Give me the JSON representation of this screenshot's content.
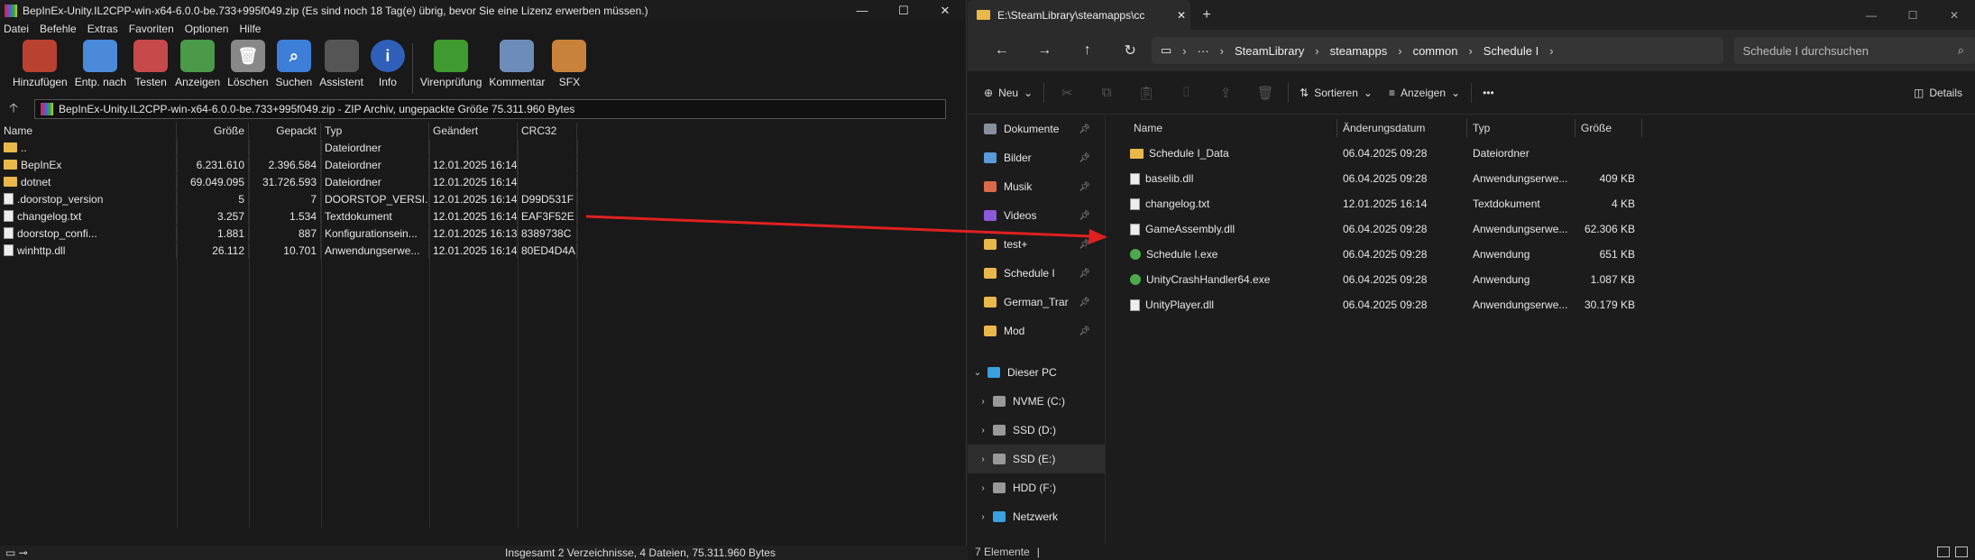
{
  "winrar": {
    "title": "BepInEx-Unity.IL2CPP-win-x64-6.0.0-be.733+995f049.zip (Es sind noch 18 Tag(e) übrig, bevor Sie eine Lizenz erwerben müssen.)",
    "menu": [
      "Datei",
      "Befehle",
      "Extras",
      "Favoriten",
      "Optionen",
      "Hilfe"
    ],
    "toolbar": [
      {
        "label": "Hinzufügen",
        "icon": "books-add-icon",
        "color": "#b9412f"
      },
      {
        "label": "Entp. nach",
        "icon": "folder-extract-icon",
        "color": "#4a8ad8"
      },
      {
        "label": "Testen",
        "icon": "clipboard-check-icon",
        "color": "#c64a4a"
      },
      {
        "label": "Anzeigen",
        "icon": "book-view-icon",
        "color": "#4a9a4a"
      },
      {
        "label": "Löschen",
        "icon": "trash-icon",
        "color": "#888"
      },
      {
        "label": "Suchen",
        "icon": "magnifier-icon",
        "color": "#3d7ed8"
      },
      {
        "label": "Assistent",
        "icon": "wand-icon",
        "color": "#555"
      },
      {
        "label": "Info",
        "icon": "info-icon",
        "color": "#2f5fb8"
      },
      {
        "label": "Virenprüfung",
        "icon": "bug-scan-icon",
        "color": "#3f9a2f"
      },
      {
        "label": "Kommentar",
        "icon": "comment-icon",
        "color": "#6d8db8"
      },
      {
        "label": "SFX",
        "icon": "sfx-books-icon",
        "color": "#c9823a"
      }
    ],
    "address": "BepInEx-Unity.IL2CPP-win-x64-6.0.0-be.733+995f049.zip - ZIP Archiv, ungepackte Größe 75.311.960 Bytes",
    "columns": [
      "Name",
      "Größe",
      "Gepackt",
      "Typ",
      "Geändert",
      "CRC32"
    ],
    "rows": [
      {
        "name": "..",
        "size": "",
        "packed": "",
        "type": "Dateiordner",
        "changed": "",
        "crc": "",
        "kind": "folder"
      },
      {
        "name": "BepInEx",
        "size": "6.231.610",
        "packed": "2.396.584",
        "type": "Dateiordner",
        "changed": "12.01.2025 16:14",
        "crc": "",
        "kind": "folder"
      },
      {
        "name": "dotnet",
        "size": "69.049.095",
        "packed": "31.726.593",
        "type": "Dateiordner",
        "changed": "12.01.2025 16:14",
        "crc": "",
        "kind": "folder"
      },
      {
        "name": ".doorstop_version",
        "size": "5",
        "packed": "7",
        "type": "DOORSTOP_VERSI...",
        "changed": "12.01.2025 16:14",
        "crc": "D99D531F",
        "kind": "file"
      },
      {
        "name": "changelog.txt",
        "size": "3.257",
        "packed": "1.534",
        "type": "Textdokument",
        "changed": "12.01.2025 16:14",
        "crc": "EAF3F52E",
        "kind": "file"
      },
      {
        "name": "doorstop_confi...",
        "size": "1.881",
        "packed": "887",
        "type": "Konfigurationsein...",
        "changed": "12.01.2025 16:13",
        "crc": "8389738C",
        "kind": "file"
      },
      {
        "name": "winhttp.dll",
        "size": "26.112",
        "packed": "10.701",
        "type": "Anwendungserwe...",
        "changed": "12.01.2025 16:14",
        "crc": "80ED4D4A",
        "kind": "file"
      }
    ],
    "status": "Insgesamt 2 Verzeichnisse, 4 Dateien, 75.311.960 Bytes"
  },
  "explorer": {
    "tab_title": "E:\\SteamLibrary\\steamapps\\cc",
    "breadcrumb": [
      "SteamLibrary",
      "steamapps",
      "common",
      "Schedule I"
    ],
    "search_placeholder": "Schedule I durchsuchen",
    "commands": {
      "new": "Neu",
      "sort": "Sortieren",
      "view": "Anzeigen",
      "details": "Details"
    },
    "nav": [
      {
        "label": "Dokumente",
        "icon": "documents-icon",
        "color": "#8a8fa0",
        "pin": true,
        "arrow": ""
      },
      {
        "label": "Bilder",
        "icon": "pictures-icon",
        "color": "#5a9ad8",
        "pin": true,
        "arrow": ""
      },
      {
        "label": "Musik",
        "icon": "music-icon",
        "color": "#d86a4a",
        "pin": true,
        "arrow": ""
      },
      {
        "label": "Videos",
        "icon": "videos-icon",
        "color": "#8a5ad8",
        "pin": true,
        "arrow": ""
      },
      {
        "label": "test+",
        "icon": "folder-icon",
        "color": "#e8b84a",
        "pin": true,
        "arrow": ""
      },
      {
        "label": "Schedule I",
        "icon": "folder-icon",
        "color": "#e8b84a",
        "pin": true,
        "arrow": ""
      },
      {
        "label": "German_Trar",
        "icon": "folder-icon",
        "color": "#e8b84a",
        "pin": true,
        "arrow": ""
      },
      {
        "label": "Mod",
        "icon": "folder-icon",
        "color": "#e8b84a",
        "pin": true,
        "arrow": ""
      },
      {
        "label": "Dieser PC",
        "icon": "pc-icon",
        "color": "#3aa0e0",
        "pin": false,
        "arrow": "v"
      },
      {
        "label": "NVME (C:)",
        "icon": "drive-icon",
        "color": "#999",
        "pin": false,
        "arrow": ">"
      },
      {
        "label": "SSD (D:)",
        "icon": "drive-icon",
        "color": "#999",
        "pin": false,
        "arrow": ">"
      },
      {
        "label": "SSD (E:)",
        "icon": "drive-icon",
        "color": "#999",
        "pin": false,
        "arrow": ">",
        "selected": true
      },
      {
        "label": "HDD (F:)",
        "icon": "drive-icon",
        "color": "#999",
        "pin": false,
        "arrow": ">"
      },
      {
        "label": "Netzwerk",
        "icon": "network-icon",
        "color": "#3aa0e0",
        "pin": false,
        "arrow": ">"
      }
    ],
    "columns": [
      "Name",
      "Änderungsdatum",
      "Typ",
      "Größe"
    ],
    "rows": [
      {
        "name": "Schedule I_Data",
        "date": "06.04.2025 09:28",
        "type": "Dateiordner",
        "size": "",
        "kind": "folder"
      },
      {
        "name": "baselib.dll",
        "date": "06.04.2025 09:28",
        "type": "Anwendungserwe...",
        "size": "409 KB",
        "kind": "file"
      },
      {
        "name": "changelog.txt",
        "date": "12.01.2025 16:14",
        "type": "Textdokument",
        "size": "4 KB",
        "kind": "file"
      },
      {
        "name": "GameAssembly.dll",
        "date": "06.04.2025 09:28",
        "type": "Anwendungserwe...",
        "size": "62.306 KB",
        "kind": "file"
      },
      {
        "name": "Schedule I.exe",
        "date": "06.04.2025 09:28",
        "type": "Anwendung",
        "size": "651 KB",
        "kind": "exe"
      },
      {
        "name": "UnityCrashHandler64.exe",
        "date": "06.04.2025 09:28",
        "type": "Anwendung",
        "size": "1.087 KB",
        "kind": "exe"
      },
      {
        "name": "UnityPlayer.dll",
        "date": "06.04.2025 09:28",
        "type": "Anwendungserwe...",
        "size": "30.179 KB",
        "kind": "file"
      }
    ],
    "status": "7 Elemente"
  },
  "annotation": {
    "arrow_color": "#e02020"
  }
}
